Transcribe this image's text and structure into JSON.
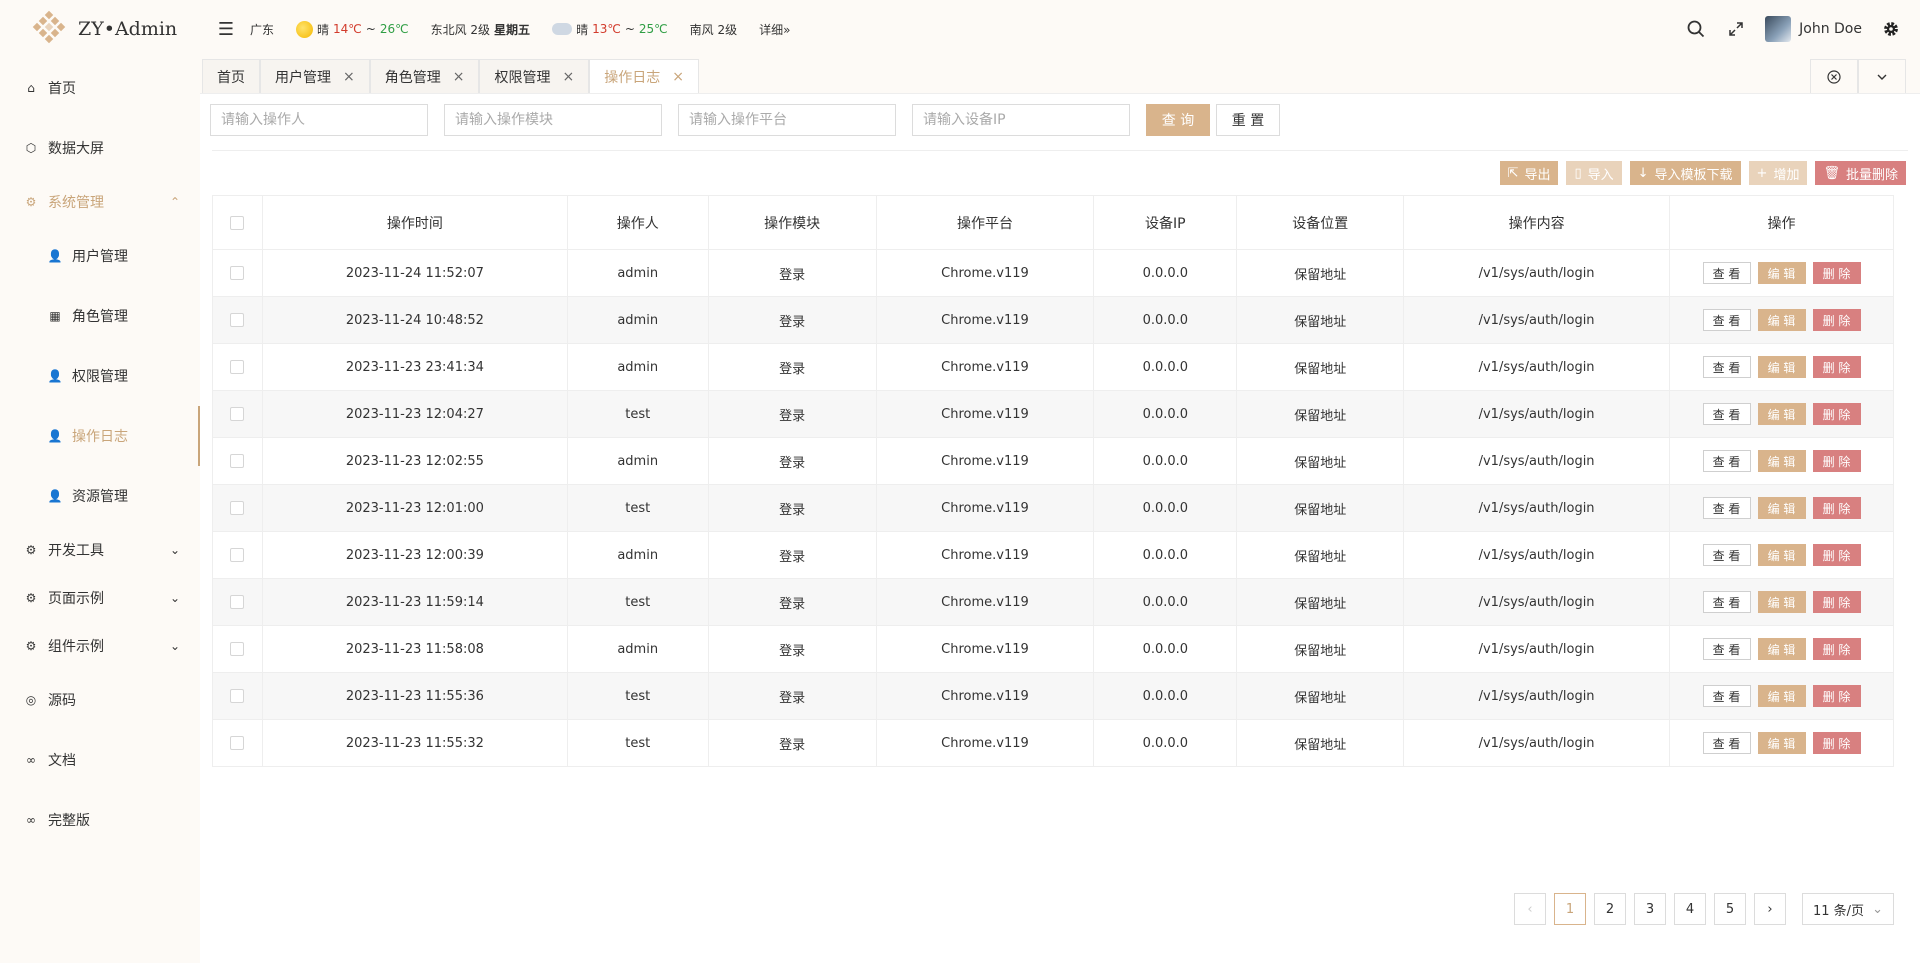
{
  "app": {
    "logo_text": "ZY•Admin"
  },
  "header": {
    "location": "广东",
    "today": {
      "weather": "晴",
      "temp_low": "14℃",
      "sep": "~",
      "temp_high": "26℃",
      "wind": "东北风 2级",
      "weekday": "星期五"
    },
    "tomorrow": {
      "weather": "晴",
      "temp_low": "13℃",
      "sep": "~",
      "temp_high": "25℃",
      "wind": "南风 2级"
    },
    "detail_link": "详细»",
    "user_name": "John Doe"
  },
  "sidebar": {
    "items": [
      {
        "label": "首页"
      },
      {
        "label": "数据大屏"
      },
      {
        "label": "系统管理"
      },
      {
        "label": "用户管理"
      },
      {
        "label": "角色管理"
      },
      {
        "label": "权限管理"
      },
      {
        "label": "操作日志"
      },
      {
        "label": "资源管理"
      },
      {
        "label": "开发工具"
      },
      {
        "label": "页面示例"
      },
      {
        "label": "组件示例"
      },
      {
        "label": "源码"
      },
      {
        "label": "文档"
      },
      {
        "label": "完整版"
      }
    ]
  },
  "tabs": [
    {
      "label": "首页"
    },
    {
      "label": "用户管理"
    },
    {
      "label": "角色管理"
    },
    {
      "label": "权限管理"
    },
    {
      "label": "操作日志"
    }
  ],
  "search": {
    "operator_placeholder": "请输入操作人",
    "module_placeholder": "请输入操作模块",
    "platform_placeholder": "请输入操作平台",
    "ip_placeholder": "请输入设备IP",
    "query_label": "查 询",
    "reset_label": "重 置"
  },
  "toolbar": {
    "export_label": "导出",
    "import_label": "导入",
    "template_label": "导入模板下载",
    "add_label": "增加",
    "batch_delete_label": "批量删除"
  },
  "table": {
    "headers": [
      "操作时间",
      "操作人",
      "操作模块",
      "操作平台",
      "设备IP",
      "设备位置",
      "操作内容",
      "操作"
    ],
    "action_labels": {
      "view": "查 看",
      "edit": "编 辑",
      "delete": "删 除"
    },
    "rows": [
      {
        "time": "2023-11-24 11:52:07",
        "operator": "admin",
        "module": "登录",
        "platform": "Chrome.v119",
        "ip": "0.0.0.0",
        "location": "保留地址",
        "content": "/v1/sys/auth/login"
      },
      {
        "time": "2023-11-24 10:48:52",
        "operator": "admin",
        "module": "登录",
        "platform": "Chrome.v119",
        "ip": "0.0.0.0",
        "location": "保留地址",
        "content": "/v1/sys/auth/login"
      },
      {
        "time": "2023-11-23 23:41:34",
        "operator": "admin",
        "module": "登录",
        "platform": "Chrome.v119",
        "ip": "0.0.0.0",
        "location": "保留地址",
        "content": "/v1/sys/auth/login"
      },
      {
        "time": "2023-11-23 12:04:27",
        "operator": "test",
        "module": "登录",
        "platform": "Chrome.v119",
        "ip": "0.0.0.0",
        "location": "保留地址",
        "content": "/v1/sys/auth/login"
      },
      {
        "time": "2023-11-23 12:02:55",
        "operator": "admin",
        "module": "登录",
        "platform": "Chrome.v119",
        "ip": "0.0.0.0",
        "location": "保留地址",
        "content": "/v1/sys/auth/login"
      },
      {
        "time": "2023-11-23 12:01:00",
        "operator": "test",
        "module": "登录",
        "platform": "Chrome.v119",
        "ip": "0.0.0.0",
        "location": "保留地址",
        "content": "/v1/sys/auth/login"
      },
      {
        "time": "2023-11-23 12:00:39",
        "operator": "admin",
        "module": "登录",
        "platform": "Chrome.v119",
        "ip": "0.0.0.0",
        "location": "保留地址",
        "content": "/v1/sys/auth/login"
      },
      {
        "time": "2023-11-23 11:59:14",
        "operator": "test",
        "module": "登录",
        "platform": "Chrome.v119",
        "ip": "0.0.0.0",
        "location": "保留地址",
        "content": "/v1/sys/auth/login"
      },
      {
        "time": "2023-11-23 11:58:08",
        "operator": "admin",
        "module": "登录",
        "platform": "Chrome.v119",
        "ip": "0.0.0.0",
        "location": "保留地址",
        "content": "/v1/sys/auth/login"
      },
      {
        "time": "2023-11-23 11:55:36",
        "operator": "test",
        "module": "登录",
        "platform": "Chrome.v119",
        "ip": "0.0.0.0",
        "location": "保留地址",
        "content": "/v1/sys/auth/login"
      },
      {
        "time": "2023-11-23 11:55:32",
        "operator": "test",
        "module": "登录",
        "platform": "Chrome.v119",
        "ip": "0.0.0.0",
        "location": "保留地址",
        "content": "/v1/sys/auth/login"
      }
    ]
  },
  "pagination": {
    "pages": [
      "1",
      "2",
      "3",
      "4",
      "5"
    ],
    "current": "1",
    "page_size_label": "11 条/页"
  },
  "colors": {
    "accent": "#d9b48c",
    "active_text": "#c9a57a",
    "danger": "#d88080"
  }
}
